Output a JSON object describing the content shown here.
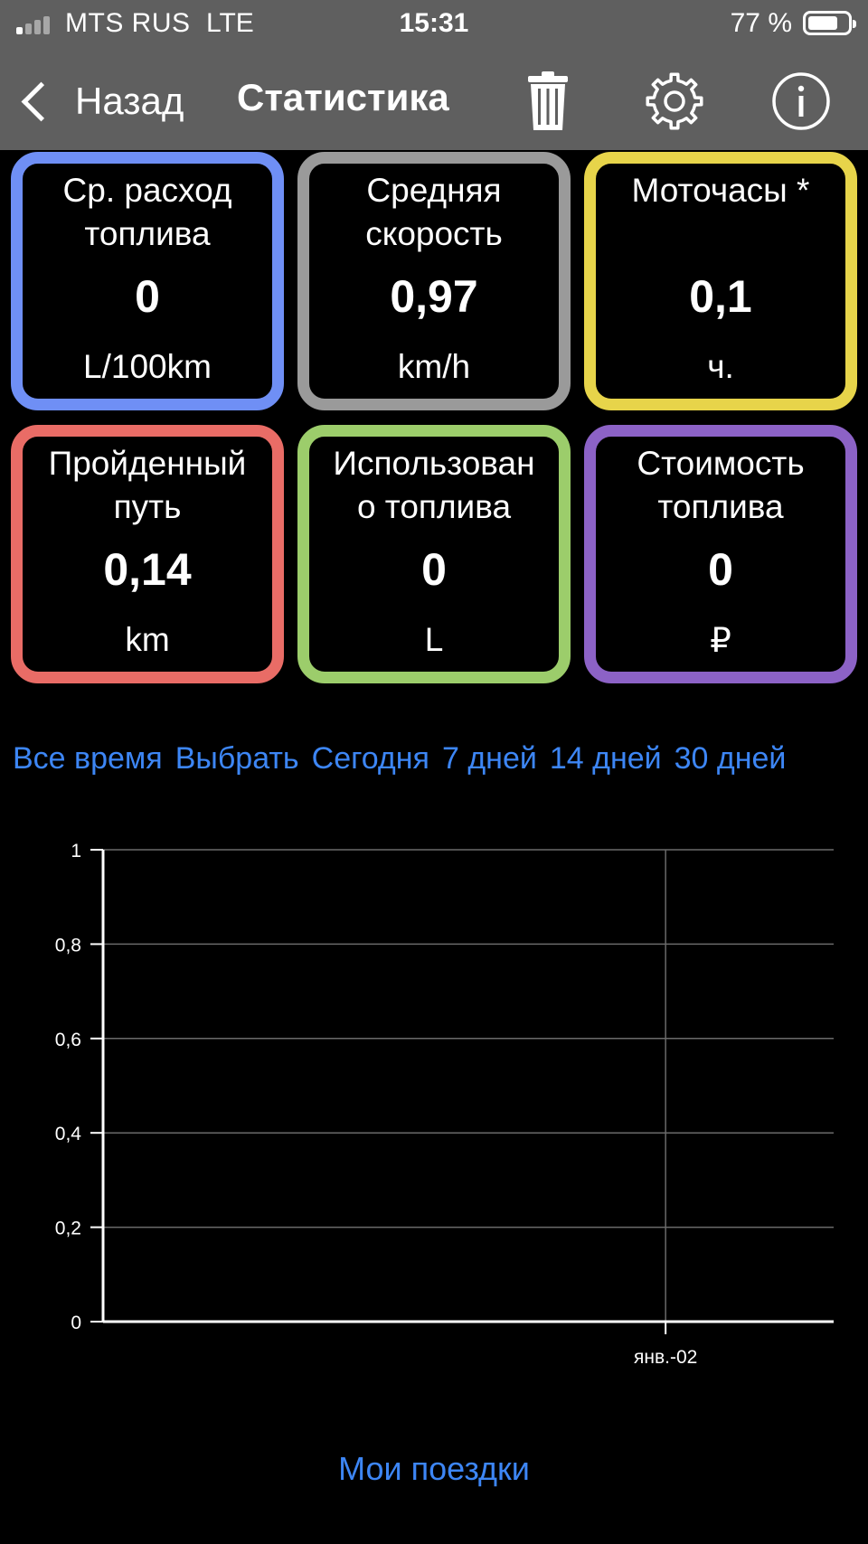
{
  "status_bar": {
    "carrier": "MTS RUS",
    "network": "LTE",
    "time": "15:31",
    "battery_text": "77 %",
    "battery_level": 0.77,
    "signal_bars_filled": 1
  },
  "navbar": {
    "back_label": "Назад",
    "title": "Статистика",
    "icons": [
      "chevron-left-icon",
      "trash-icon",
      "gear-icon",
      "info-icon"
    ]
  },
  "tiles": [
    {
      "title": "Ср. расход топлива",
      "value": "0",
      "unit": "L/100km",
      "color": "#6f8ff5"
    },
    {
      "title": "Средняя скорость",
      "value": "0,97",
      "unit": "km/h",
      "color": "#9a9a9a"
    },
    {
      "title": "Моточасы *",
      "value": "0,1",
      "unit": "ч.",
      "color": "#e7d44a"
    },
    {
      "title": "Пройденный путь",
      "value": "0,14",
      "unit": "km",
      "color": "#e96c66"
    },
    {
      "title": "Использовано топлива",
      "value": "0",
      "unit": "L",
      "color": "#9ccd6b"
    },
    {
      "title": "Стоимость топлива",
      "value": "0",
      "unit": "₽",
      "color": "#8c62c6"
    }
  ],
  "tile_title_lines": [
    [
      "Ср. расход",
      "топлива"
    ],
    [
      "Средняя",
      "скорость"
    ],
    [
      "Моточасы *",
      ""
    ],
    [
      "Пройденный",
      "путь"
    ],
    [
      "Использован",
      "о топлива"
    ],
    [
      "Стоимость",
      "топлива"
    ]
  ],
  "periods": [
    "Все время",
    "Выбрать",
    "Сегодня",
    "7 дней",
    "14 дней",
    "30 дней"
  ],
  "chart_data": {
    "type": "line",
    "title": "",
    "xlabel": "",
    "ylabel": "",
    "ylim": [
      0,
      1
    ],
    "y_ticks": [
      "0",
      "0,2",
      "0,4",
      "0,6",
      "0,8",
      "1"
    ],
    "categories": [
      "янв.-02"
    ],
    "series": [],
    "grid": true
  },
  "footer": {
    "my_trips_label": "Мои поездки"
  },
  "colors": {
    "link": "#3d86f5",
    "bar": "#5f5f5f"
  }
}
